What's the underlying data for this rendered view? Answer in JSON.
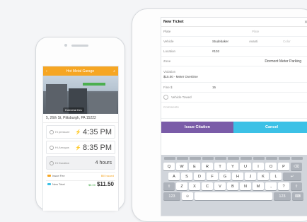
{
  "phone": {
    "header_title": "Hot Metal Garage",
    "photo_caption": "Hotmetal Dev",
    "address": "5, 26th St, Pittsburgh, PA 15222",
    "rows": [
      {
        "label": "Hi pressure",
        "value": "4:35 PM"
      },
      {
        "label": "Hi-Amogus",
        "value": "8:35 PM"
      }
    ],
    "duration": {
      "label": "Hi Duration",
      "value": "4 hours"
    },
    "fee_row": {
      "label": "Issue Fee",
      "note": "Bill Issued"
    },
    "total_row": {
      "label": "New Total",
      "discount": "$5.00",
      "price": "$11.50"
    },
    "accent_color": "#f6a623"
  },
  "tablet": {
    "title": "New Ticket",
    "close": "✕",
    "fields": {
      "plate": {
        "label": "Plate",
        "hint": "Plate"
      },
      "vehicle": {
        "label": "Vehicle",
        "value": "Studebaker",
        "extra_label": "Avanti",
        "extra_value": "Color"
      },
      "location": {
        "label": "Location",
        "value": "#103"
      },
      "zone": {
        "label": "Zone",
        "value": "Dormont Meter Parking"
      },
      "violation": {
        "label": "Violation",
        "value": "$15.00 - Meter Overtime"
      },
      "fine": {
        "label": "Fine $",
        "value": "15"
      },
      "towed": {
        "label": "Vehicle Towed"
      },
      "comments": {
        "label": "Comments"
      }
    },
    "buttons": {
      "issue": "Issue Citation",
      "cancel": "Cancel"
    },
    "issue_color": "#7a5ca8",
    "cancel_color": "#3cc1e6"
  },
  "keyboard": {
    "row1": [
      "Q",
      "W",
      "E",
      "R",
      "T",
      "Y",
      "U",
      "I",
      "O",
      "P",
      "⌫"
    ],
    "row2": [
      "A",
      "S",
      "D",
      "F",
      "G",
      "H",
      "J",
      "K",
      "L",
      "↵"
    ],
    "row3": [
      "⇧",
      "Z",
      "X",
      "C",
      "V",
      "B",
      "N",
      "M",
      ",",
      "?",
      "⇧"
    ],
    "row4": {
      "left": "123",
      "right": "123"
    }
  }
}
